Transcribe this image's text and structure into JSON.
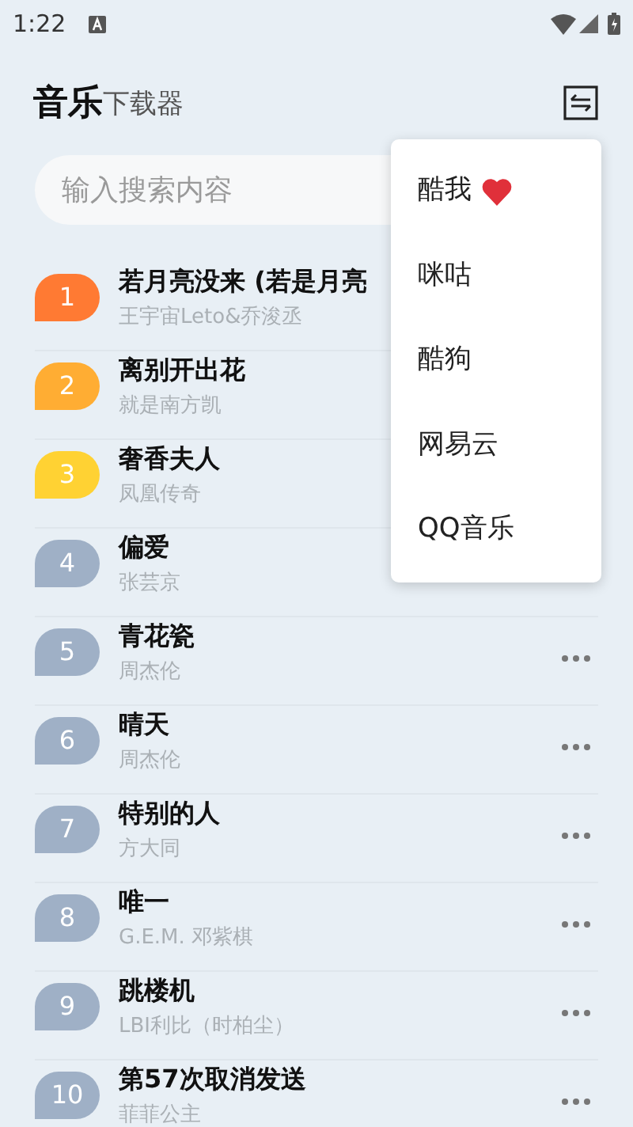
{
  "status_bar": {
    "time": "1:22"
  },
  "header": {
    "title": "音乐",
    "subtitle": "下载器"
  },
  "search": {
    "placeholder": "输入搜索内容"
  },
  "songs": [
    {
      "rank": "1",
      "title": "若月亮没来 (若是月亮",
      "artist": "王宇宙Leto&乔浚丞",
      "color": "#ff7a33",
      "has_more": false
    },
    {
      "rank": "2",
      "title": "离别开出花",
      "artist": "就是南方凯",
      "color": "#ffad33",
      "has_more": false
    },
    {
      "rank": "3",
      "title": "奢香夫人",
      "artist": "凤凰传奇",
      "color": "#ffd233",
      "has_more": false
    },
    {
      "rank": "4",
      "title": "偏爱",
      "artist": "张芸京",
      "color": "#9fb0c6",
      "has_more": false
    },
    {
      "rank": "5",
      "title": "青花瓷",
      "artist": "周杰伦",
      "color": "#9fb0c6",
      "has_more": true
    },
    {
      "rank": "6",
      "title": "晴天",
      "artist": "周杰伦",
      "color": "#9fb0c6",
      "has_more": true
    },
    {
      "rank": "7",
      "title": "特别的人",
      "artist": "方大同",
      "color": "#9fb0c6",
      "has_more": true
    },
    {
      "rank": "8",
      "title": "唯一",
      "artist": "G.E.M. 邓紫棋",
      "color": "#9fb0c6",
      "has_more": true
    },
    {
      "rank": "9",
      "title": "跳楼机",
      "artist": "LBI利比（时柏尘）",
      "color": "#9fb0c6",
      "has_more": true
    },
    {
      "rank": "10",
      "title": "第57次取消发送",
      "artist": "菲菲公主",
      "color": "#9fb0c6",
      "has_more": true
    }
  ],
  "menu": [
    {
      "label": "酷我",
      "heart": true
    },
    {
      "label": "咪咕",
      "heart": false
    },
    {
      "label": "酷狗",
      "heart": false
    },
    {
      "label": "网易云",
      "heart": false
    },
    {
      "label": "QQ音乐",
      "heart": false
    }
  ]
}
